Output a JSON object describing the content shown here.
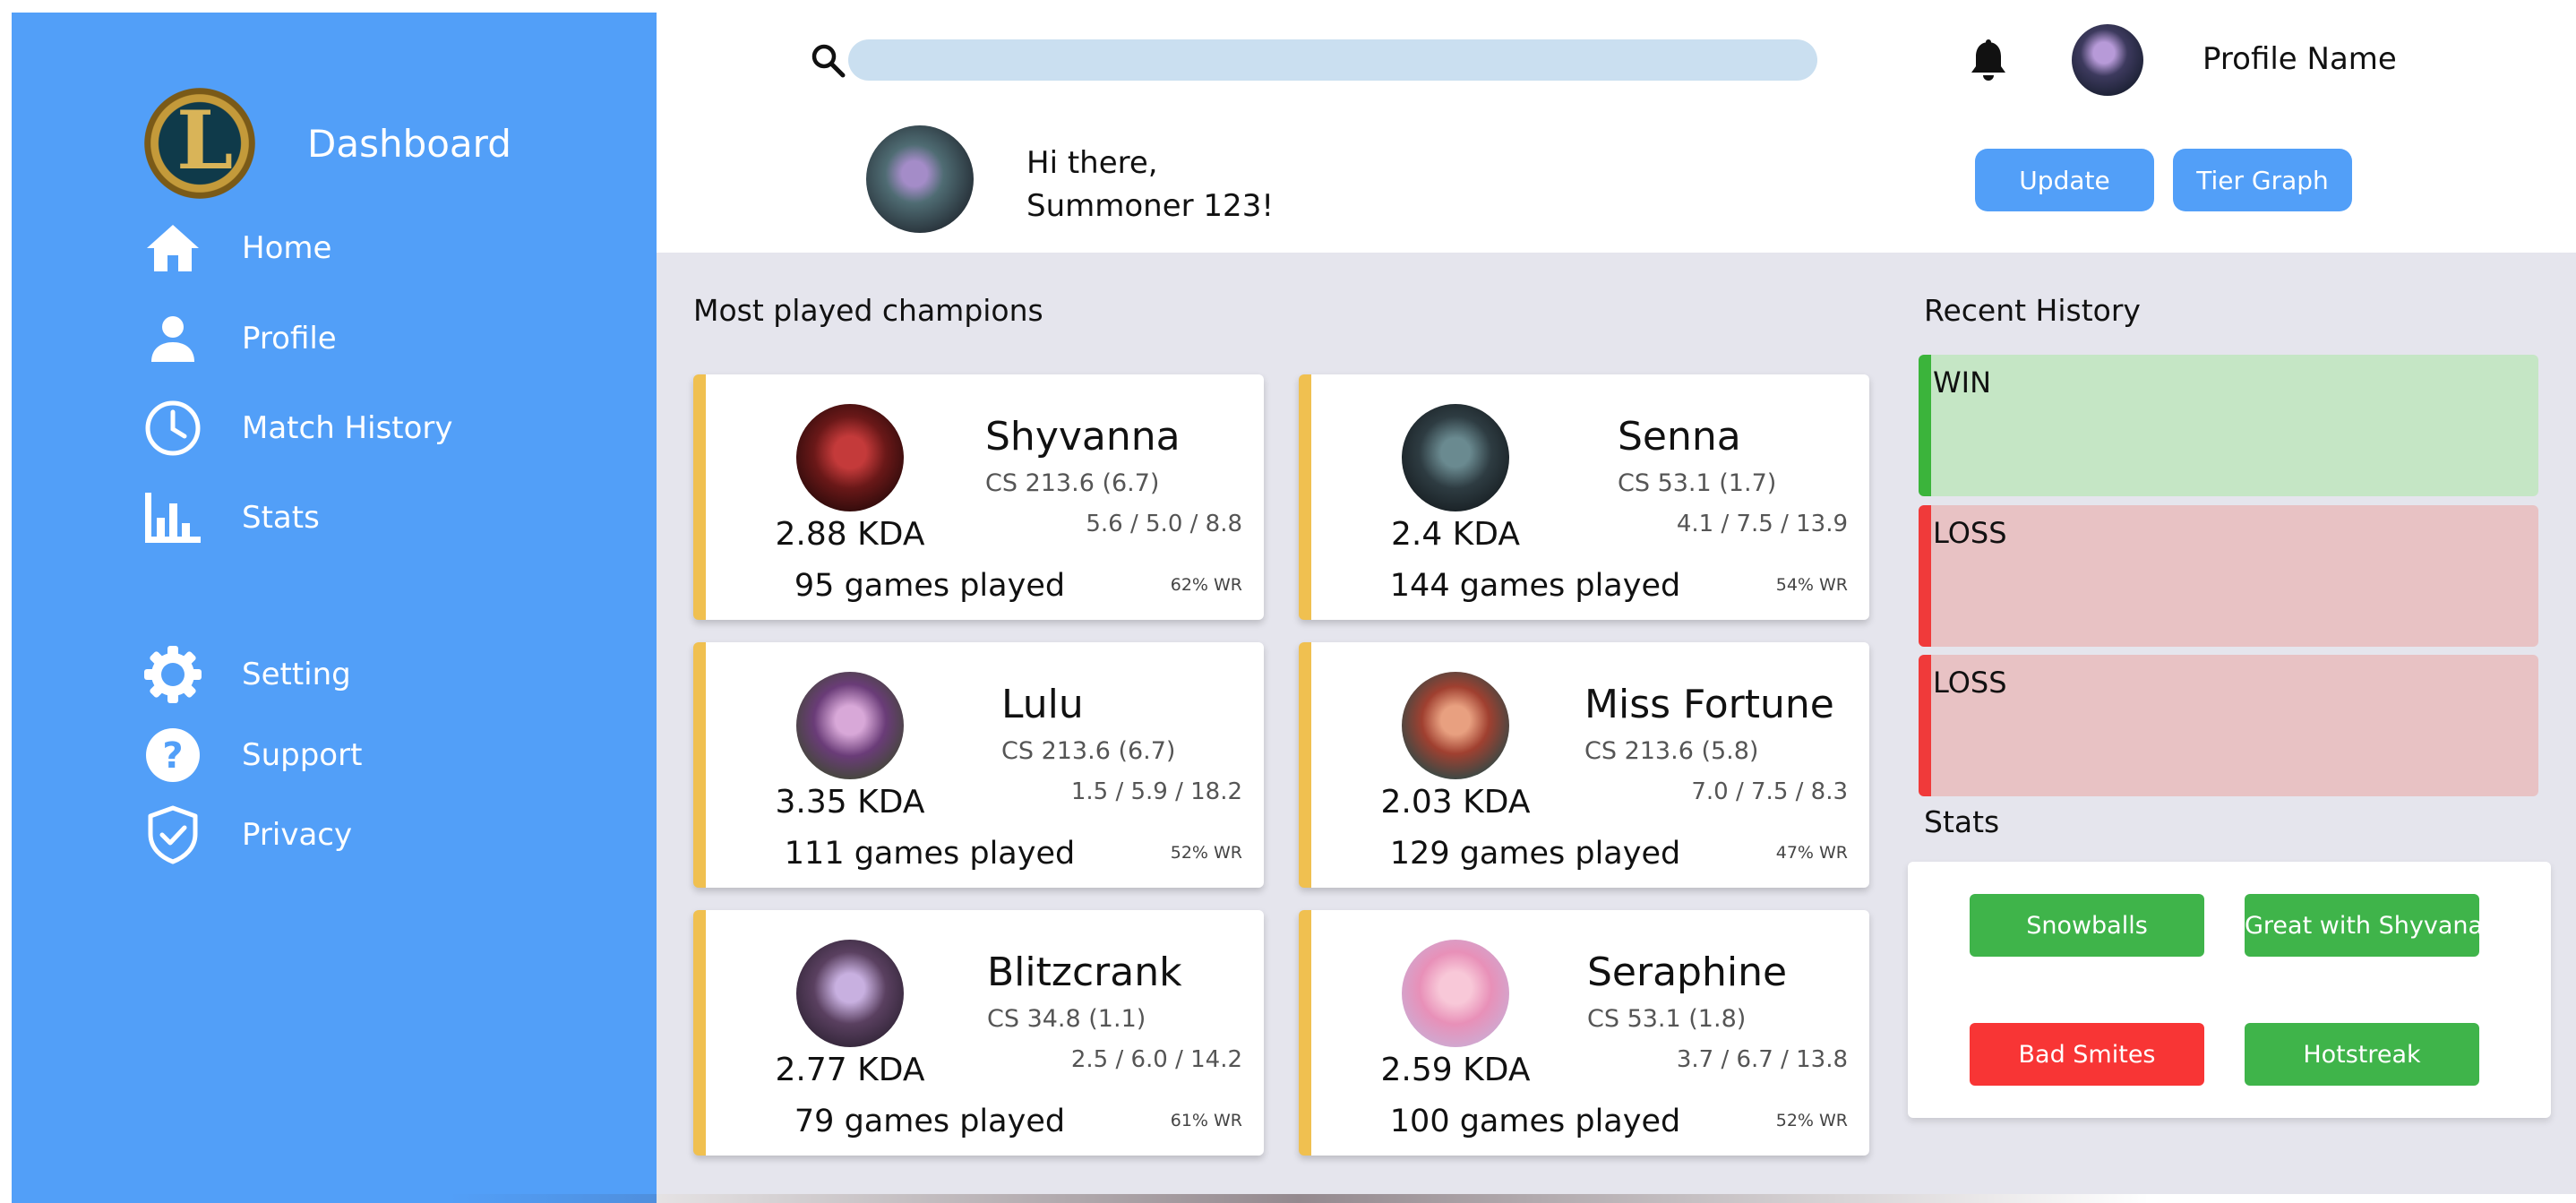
{
  "sidebar": {
    "title": "Dashboard",
    "logo_letter": "L",
    "items": [
      {
        "label": "Home",
        "icon": "home-icon"
      },
      {
        "label": "Profile",
        "icon": "person-icon"
      },
      {
        "label": "Match History",
        "icon": "clock-icon"
      },
      {
        "label": "Stats",
        "icon": "bar-chart-icon"
      },
      {
        "label": "Setting",
        "icon": "gear-icon"
      },
      {
        "label": "Support",
        "icon": "question-icon"
      },
      {
        "label": "Privacy",
        "icon": "shield-icon"
      }
    ]
  },
  "header": {
    "search_placeholder": "",
    "profile_name": "Profile Name",
    "greeting_line1": "Hi there,",
    "greeting_line2": "Summoner 123!",
    "update_label": "Update",
    "tier_graph_label": "Tier Graph"
  },
  "main": {
    "champions_title": "Most played champions",
    "history_title": "Recent History",
    "stats_title": "Stats"
  },
  "champions": [
    {
      "name": "Shyvanna",
      "cs": "CS 213.6 (6.7)",
      "kda": "2.88 KDA",
      "ratio": "5.6 / 5.0 / 8.8",
      "games": "95 games played",
      "wr": "62% WR"
    },
    {
      "name": "Senna",
      "cs": "CS 53.1 (1.7)",
      "kda": "2.4 KDA",
      "ratio": "4.1 / 7.5 / 13.9",
      "games": "144 games played",
      "wr": "54% WR"
    },
    {
      "name": "Lulu",
      "cs": "CS 213.6 (6.7)",
      "kda": "3.35 KDA",
      "ratio": "1.5 / 5.9 / 18.2",
      "games": "111 games played",
      "wr": "52% WR"
    },
    {
      "name": "Miss Fortune",
      "cs": "CS 213.6 (5.8)",
      "kda": "2.03 KDA",
      "ratio": "7.0 / 7.5 / 8.3",
      "games": "129 games played",
      "wr": "47% WR"
    },
    {
      "name": "Blitzcrank",
      "cs": "CS 34.8 (1.1)",
      "kda": "2.77 KDA",
      "ratio": "2.5 / 6.0 / 14.2",
      "games": "79 games played",
      "wr": "61% WR"
    },
    {
      "name": "Seraphine",
      "cs": "CS 53.1 (1.8)",
      "kda": "2.59 KDA",
      "ratio": "3.7 / 6.7 / 13.8",
      "games": "100 games played",
      "wr": "52% WR"
    }
  ],
  "history": [
    {
      "result": "WIN"
    },
    {
      "result": "LOSS"
    },
    {
      "result": "LOSS"
    }
  ],
  "stats": [
    {
      "label": "Snowballs",
      "status": "good"
    },
    {
      "label": "Great with Shyvana",
      "status": "good"
    },
    {
      "label": "Bad Smites",
      "status": "bad"
    },
    {
      "label": "Hotstreak",
      "status": "good"
    }
  ],
  "colors": {
    "sidebar": "#529ff8",
    "accent_button": "#529ff8",
    "card_accent": "#f0c050",
    "win": "#3bb43b",
    "loss": "#f03a3a",
    "good_badge": "#3fb44a",
    "bad_badge": "#f83535"
  }
}
